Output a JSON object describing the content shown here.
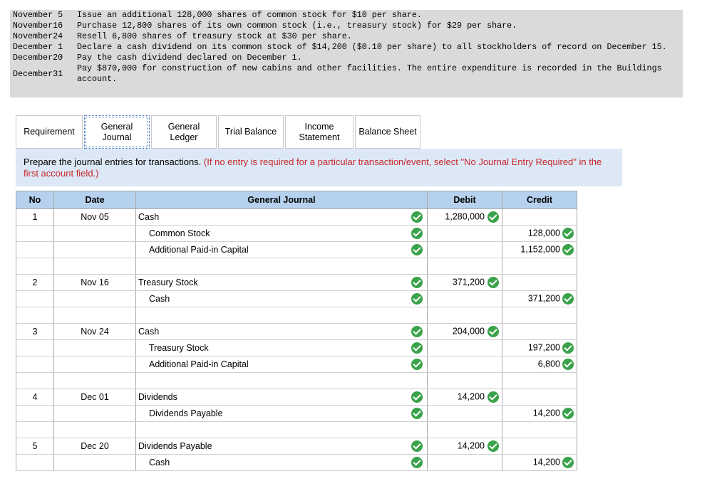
{
  "transactions": [
    {
      "date": "November 5",
      "text": "Issue an additional 128,000 shares of common stock for $10 per share."
    },
    {
      "date": "November16",
      "text": "Purchase 12,800 shares of its own common stock (i.e., treasury stock) for $29 per share."
    },
    {
      "date": "November24",
      "text": "Resell 6,800 shares of treasury stock at $30 per share."
    },
    {
      "date": "December 1",
      "text": "Declare a cash dividend on its common stock of $14,200 ($0.10 per share) to all stockholders of record on December 15."
    },
    {
      "date": "December20",
      "text": "Pay the cash dividend declared on December 1."
    },
    {
      "date": "December31",
      "text": "Pay $870,000 for construction of new cabins and other facilities. The entire expenditure is recorded in the Buildings account."
    }
  ],
  "tabs": [
    {
      "label": "Requirement",
      "width": 92
    },
    {
      "label": "General Journal",
      "width": 92
    },
    {
      "label": "General Ledger",
      "width": 92
    },
    {
      "label": "Trial Balance",
      "width": 92
    },
    {
      "label": "Income Statement",
      "width": 92
    },
    {
      "label": "Balance Sheet",
      "width": 92
    }
  ],
  "instruction": {
    "main": "Prepare the journal entries for transactions. ",
    "note": "(If no entry is required for a particular transaction/event, select \"No Journal Entry Required\" in the first account field.)"
  },
  "journal": {
    "headers": {
      "no": "No",
      "date": "Date",
      "account": "General Journal",
      "debit": "Debit",
      "credit": "Credit"
    },
    "entries": [
      {
        "no": "1",
        "date": "Nov 05",
        "lines": [
          {
            "account": "Cash",
            "debit": "1,280,000",
            "credit": ""
          },
          {
            "account": "Common Stock",
            "debit": "",
            "credit": "128,000"
          },
          {
            "account": "Additional Paid-in Capital",
            "debit": "",
            "credit": "1,152,000"
          }
        ]
      },
      {
        "no": "2",
        "date": "Nov 16",
        "lines": [
          {
            "account": "Treasury Stock",
            "debit": "371,200",
            "credit": ""
          },
          {
            "account": "Cash",
            "debit": "",
            "credit": "371,200"
          }
        ]
      },
      {
        "no": "3",
        "date": "Nov 24",
        "lines": [
          {
            "account": "Cash",
            "debit": "204,000",
            "credit": ""
          },
          {
            "account": "Treasury Stock",
            "debit": "",
            "credit": "197,200"
          },
          {
            "account": "Additional Paid-in Capital",
            "debit": "",
            "credit": "6,800"
          }
        ]
      },
      {
        "no": "4",
        "date": "Dec 01",
        "lines": [
          {
            "account": "Dividends",
            "debit": "14,200",
            "credit": ""
          },
          {
            "account": "Dividends Payable",
            "debit": "",
            "credit": "14,200"
          }
        ]
      },
      {
        "no": "5",
        "date": "Dec 20",
        "lines": [
          {
            "account": "Dividends Payable",
            "debit": "14,200",
            "credit": ""
          },
          {
            "account": "Cash",
            "debit": "",
            "credit": "14,200"
          }
        ]
      }
    ]
  },
  "colors": {
    "check": "#3aa24a",
    "header_bg": "#b5d1ee",
    "instruction_bg": "#dce8f6",
    "note_red": "#c8262a"
  }
}
